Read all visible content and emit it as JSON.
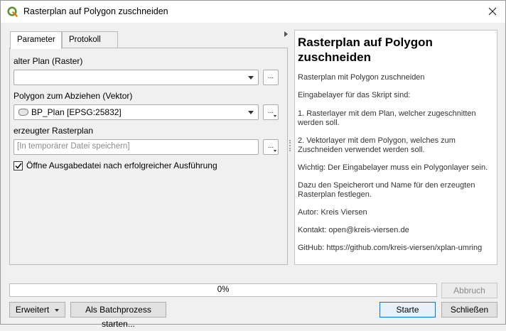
{
  "window": {
    "title": "Rasterplan auf Polygon zuschneiden"
  },
  "tabs": [
    {
      "label": "Parameter",
      "active": true
    },
    {
      "label": "Protokoll",
      "active": false
    }
  ],
  "params": {
    "raster_label": "alter Plan (Raster)",
    "raster_value": "",
    "polygon_label": "Polygon zum Abziehen (Vektor)",
    "polygon_value": "BP_Plan [EPSG:25832]",
    "output_label": "erzeugter Rasterplan",
    "output_placeholder": "[In temporärer Datei speichern]",
    "browse_label": "...",
    "open_output_label": "Öffne Ausgabedatei nach erfolgreicher Ausführung",
    "open_output_checked": true
  },
  "help": {
    "title": "Rasterplan auf Polygon zuschneiden",
    "paragraphs": [
      "Rasterplan mit Polygon zuschneiden",
      "Eingabelayer für das Skript sind:",
      "1. Rasterlayer mit dem Plan, welcher zugeschnitten werden soll.",
      "2. Vektorlayer mit dem Polygon, welches zum Zuschneiden verwendet werden soll.",
      "Wichtig: Der Eingabelayer muss ein Polygonlayer sein.",
      "Dazu den Speicherort und Name für den erzeugten Rasterplan festlegen.",
      "Autor: Kreis Viersen",
      "Kontakt: open@kreis-viersen.de",
      "GitHub: https://github.com/kreis-viersen/xplan-umring"
    ]
  },
  "progress": {
    "percent_label": "0%",
    "value": 0
  },
  "buttons": {
    "cancel": "Abbruch",
    "advanced": "Erweitert",
    "batch": "Als Batchprozess starten...",
    "run": "Starte",
    "close": "Schließen"
  },
  "colors": {
    "qgis_green": "#589632",
    "qgis_yellow": "#ee7913",
    "primary_border": "#0078d7"
  },
  "icons": {
    "app": "qgis-logo-icon",
    "close": "close-icon",
    "polygon_layer": "polygon-layer-icon"
  }
}
